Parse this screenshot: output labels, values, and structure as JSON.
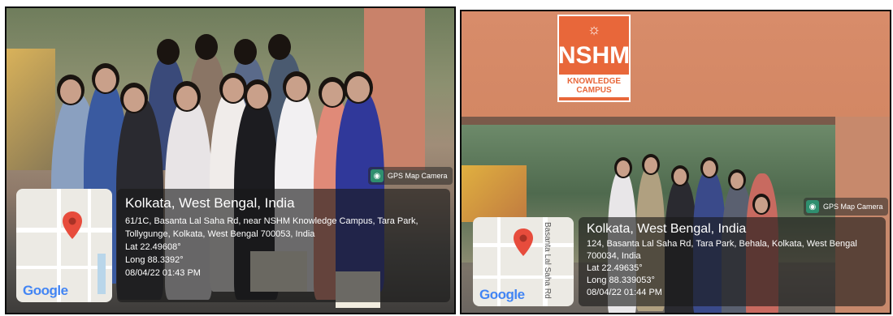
{
  "photos": [
    {
      "gps_badge": "GPS Map Camera",
      "google": "Google",
      "title": "Kolkata, West Bengal, India",
      "address": "61/1C, Basanta Lal Saha Rd, near NSHM Knowledge Campus, Tara Park, Tollygunge, Kolkata, West Bengal 700053, India",
      "lat": "Lat 22.49608°",
      "long": "Long 88.3392°",
      "datetime": "08/04/22 01:43 PM"
    },
    {
      "sign_title": "NSHM",
      "sign_sub_1": "KNOWLEDGE",
      "sign_sub_2": "CAMPUS",
      "gps_badge": "GPS Map Camera",
      "google": "Google",
      "street_name": "Basanta Lal Saha Rd",
      "title": "Kolkata, West Bengal, India",
      "address": "124, Basanta Lal Saha Rd, Tara Park, Behala, Kolkata, West Bengal 700034, India",
      "lat": "Lat 22.49635°",
      "long": "Long 88.339053°",
      "datetime": "08/04/22 01:44 PM"
    }
  ],
  "colors": {
    "sign_orange": "#e8673a",
    "pin_red": "#e74c3c",
    "card_overlay": "rgba(25,25,25,0.62)"
  }
}
